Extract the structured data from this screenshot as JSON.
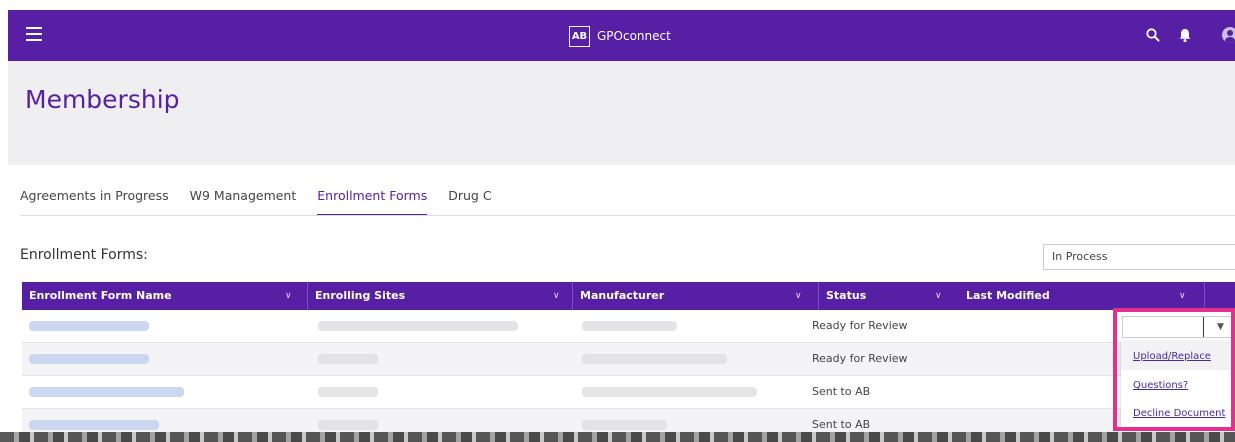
{
  "header": {
    "brand_logo": "AB",
    "brand_name": "GPOconnect",
    "icons": [
      "menu-icon",
      "search-icon",
      "bell-icon",
      "avatar-icon"
    ]
  },
  "page": {
    "title": "Membership"
  },
  "tabs": [
    {
      "label": "Agreements in Progress",
      "active": false
    },
    {
      "label": "W9 Management",
      "active": false
    },
    {
      "label": "Enrollment Forms",
      "active": true
    },
    {
      "label": "Drug C",
      "active": false
    }
  ],
  "section": {
    "title": "Enrollment Forms:",
    "filter_value": "In Process"
  },
  "table": {
    "columns": [
      "Enrollment Form Name",
      "Enrolling Sites",
      "Manufacturer",
      "Status",
      "Last Modified"
    ],
    "rows": [
      {
        "status": "Ready for Review"
      },
      {
        "status": "Ready for Review"
      },
      {
        "status": "Sent to AB"
      },
      {
        "status": "Sent to AB"
      }
    ]
  },
  "row_actions": {
    "menu_items": [
      "Upload/Replace",
      "Questions?",
      "Decline Document"
    ]
  },
  "colors": {
    "brand": "#5720a4",
    "highlight": "#e2318d",
    "link": "#4a2aa0"
  }
}
